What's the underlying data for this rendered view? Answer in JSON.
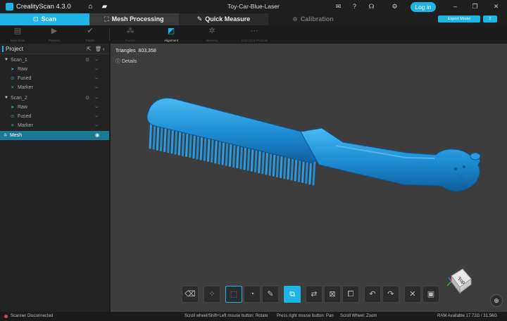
{
  "app": {
    "name": "CrealityScan 4.3.0",
    "doc_title": "Toy-Car-Blue-Laser",
    "login_label": "Log in"
  },
  "tabs": [
    {
      "label": "Scan",
      "icon": "scan-icon"
    },
    {
      "label": "Mesh Processing",
      "icon": "mesh-icon"
    },
    {
      "label": "Quick Measure",
      "icon": "ruler-icon"
    },
    {
      "label": "Calibration",
      "icon": "target-icon"
    }
  ],
  "export": {
    "label": "Export Model",
    "share": "share-icon"
  },
  "toolbar": [
    {
      "label": "New Scan",
      "icon": "new-scan-icon"
    },
    {
      "label": "Preview",
      "icon": "play-icon"
    },
    {
      "label": "Finish",
      "icon": "check-icon"
    },
    {
      "label": "Fusion",
      "icon": "fusion-icon"
    },
    {
      "label": "Alignment",
      "icon": "alignment-icon"
    },
    {
      "label": "Meshing",
      "icon": "meshing-icon"
    },
    {
      "label": "One-Click Process",
      "icon": "one-click-icon"
    }
  ],
  "project": {
    "title": "Project",
    "tree": [
      {
        "label": "Scan_1",
        "type": "group"
      },
      {
        "label": "Raw",
        "type": "child"
      },
      {
        "label": "Fused",
        "type": "child"
      },
      {
        "label": "Marker",
        "type": "child"
      },
      {
        "label": "Scan_2",
        "type": "group"
      },
      {
        "label": "Raw",
        "type": "child"
      },
      {
        "label": "Fused",
        "type": "child"
      },
      {
        "label": "Marker",
        "type": "child"
      },
      {
        "label": "Mesh",
        "type": "mesh",
        "selected": true
      }
    ]
  },
  "viewport": {
    "triangles_label": "Triangles",
    "triangles_value": "803,358",
    "details_label": "Details",
    "cube_label": "Top",
    "model_color": "#1f8fd6"
  },
  "status": {
    "scanner": "Scanner Disconnected",
    "hint_rotate": "Scroll wheel/Shift+Left mouse button: Rotate",
    "hint_pan": "Press right mouse button: Pan",
    "hint_zoom": "Scroll Wheel: Zoom",
    "ram": "RAM Available 17.72G / 31.56G"
  },
  "colors": {
    "accent": "#1fb4e6",
    "status_error": "#e24545"
  }
}
